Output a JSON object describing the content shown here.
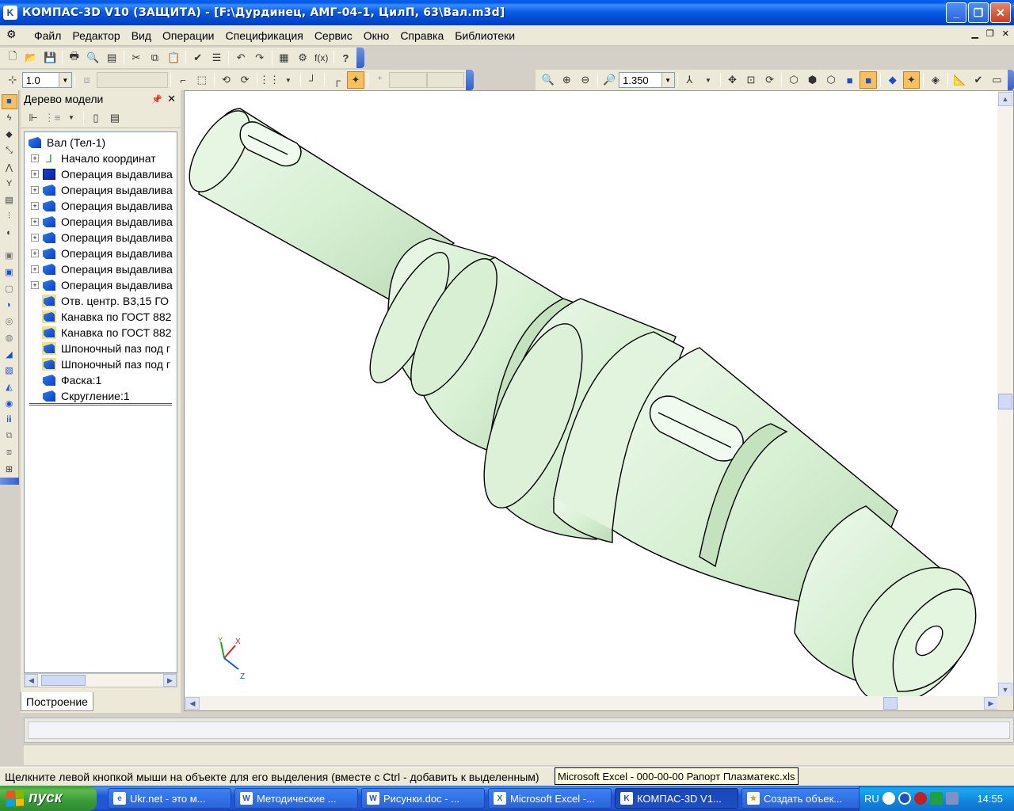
{
  "window": {
    "title": "КОМПАС-3D V10 (ЗАЩИТА) - [F:\\Дурдинец, АМГ-04-1, ЦилП, 63\\Вал.m3d]",
    "app_icon": "K"
  },
  "menu": {
    "items": [
      "Файл",
      "Редактор",
      "Вид",
      "Операции",
      "Спецификация",
      "Сервис",
      "Окно",
      "Справка",
      "Библиотеки"
    ]
  },
  "toolbar": {
    "fx_label": "f(x)",
    "step_value": "1.0",
    "zoom_value": "1.350"
  },
  "tree": {
    "header": "Дерево модели",
    "root": "Вал (Тел-1)",
    "items": [
      {
        "label": "Начало координат",
        "expandable": true,
        "icon": "axes-icon"
      },
      {
        "label": "Операция выдавлива",
        "expandable": true,
        "icon": "extrude-icon"
      },
      {
        "label": "Операция выдавлива",
        "expandable": true,
        "icon": "extrude-icon"
      },
      {
        "label": "Операция выдавлива",
        "expandable": true,
        "icon": "extrude-icon"
      },
      {
        "label": "Операция выдавлива",
        "expandable": true,
        "icon": "extrude-icon"
      },
      {
        "label": "Операция выдавлива",
        "expandable": true,
        "icon": "extrude-icon"
      },
      {
        "label": "Операция выдавлива",
        "expandable": true,
        "icon": "extrude-icon"
      },
      {
        "label": "Операция выдавлива",
        "expandable": true,
        "icon": "extrude-icon"
      },
      {
        "label": "Операция выдавлива",
        "expandable": true,
        "icon": "extrude-icon"
      },
      {
        "label": "Отв. центр. В3,15 ГО",
        "expandable": false,
        "icon": "library-feature-icon"
      },
      {
        "label": "Канавка по ГОСТ 882",
        "expandable": false,
        "icon": "library-feature-icon"
      },
      {
        "label": "Канавка по ГОСТ 882",
        "expandable": false,
        "icon": "library-feature-icon"
      },
      {
        "label": "Шпоночный паз под г",
        "expandable": false,
        "icon": "library-feature-icon"
      },
      {
        "label": "Шпоночный паз под г",
        "expandable": false,
        "icon": "library-feature-icon"
      },
      {
        "label": "Фаска:1",
        "expandable": false,
        "icon": "chamfer-icon"
      },
      {
        "label": "Скругление:1",
        "expandable": false,
        "icon": "fillet-icon"
      }
    ],
    "tab": "Построение"
  },
  "viewport": {
    "axis_x": "X",
    "axis_y": "Y",
    "axis_z": "Z",
    "model_color": "#d8f0d4"
  },
  "status": {
    "hint": "Щелкните левой кнопкой мыши на объекте для его выделения (вместе с Ctrl - добавить к выделенным)",
    "tooltip": "Microsoft Excel - 000-00-00 Рапорт Плазматекс.xls"
  },
  "taskbar": {
    "start": "пуск",
    "tasks": [
      {
        "label": "Ukr.net - это м...",
        "icon": "ie-icon",
        "active": false
      },
      {
        "label": "Методические ...",
        "icon": "word-icon",
        "active": false
      },
      {
        "label": "Рисунки.doc - ...",
        "icon": "word-icon",
        "active": false
      },
      {
        "label": "Microsoft Excel -...",
        "icon": "excel-icon",
        "active": false
      },
      {
        "label": "КОМПАС-3D V1...",
        "icon": "kompas-icon",
        "active": true
      },
      {
        "label": "Создать объек...",
        "icon": "app-icon",
        "active": false
      }
    ],
    "lang": "RU",
    "clock": "14:55"
  }
}
